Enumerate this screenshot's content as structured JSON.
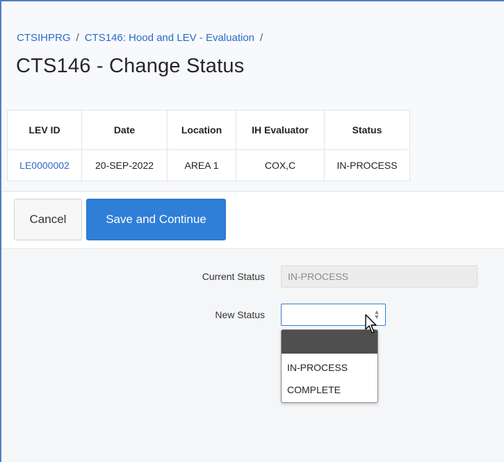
{
  "breadcrumb": {
    "item1": "CTSIHPRG",
    "item2": "CTS146: Hood and LEV - Evaluation",
    "separator": "/"
  },
  "page_title": "CTS146 - Change Status",
  "table": {
    "headers": [
      "LEV ID",
      "Date",
      "Location",
      "IH Evaluator",
      "Status"
    ],
    "rows": [
      [
        "LE0000002",
        "20-SEP-2022",
        "AREA 1",
        "COX,C",
        "IN-PROCESS"
      ]
    ]
  },
  "buttons": {
    "cancel": "Cancel",
    "save": "Save and Continue"
  },
  "form": {
    "current_status_label": "Current Status",
    "current_status_value": "IN-PROCESS",
    "new_status_label": "New Status",
    "new_status_value": "",
    "options": [
      "",
      "IN-PROCESS",
      "COMPLETE"
    ]
  },
  "colors": {
    "accent": "#2f7ed8",
    "link": "#2a6cc2",
    "frame_border": "#4f7fbf",
    "highlighted_option": "#4f4f4f"
  }
}
